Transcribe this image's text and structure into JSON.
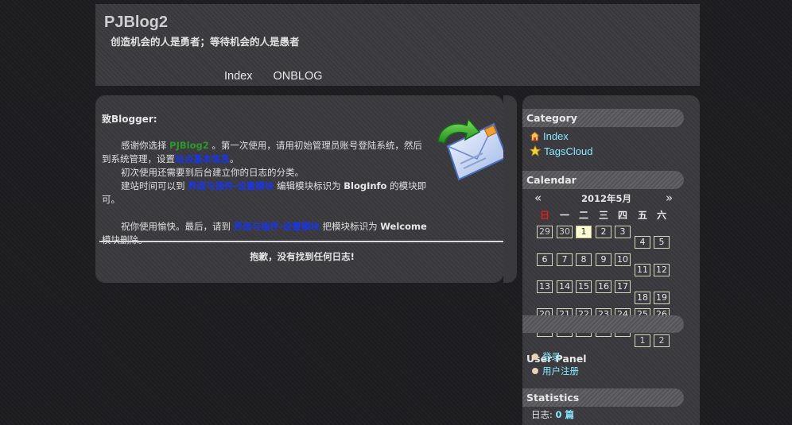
{
  "header": {
    "site_title": "PJBlog2",
    "subtitle": "创造机会的人是勇者；等待机会的人是愚者",
    "nav": [
      "Index",
      "ONBLOG"
    ]
  },
  "notice": {
    "heading": "致Blogger:",
    "p1_a": "感谢你选择 ",
    "p1_link": "PJBlog2",
    "p1_b": " 。第一次使用，请用初始管理员账号登陆系统，然后到系统管理，设置",
    "p1_link2": "站点基本信息",
    "p1_c": "。",
    "p2": "初次使用还需要到后台建立你的日志的分类。",
    "p3_a": "建站时间可以到 ",
    "p3_link": "界面与插件-设置模块",
    "p3_b": " 编辑模块标识为 ",
    "p3_key": "BlogInfo",
    "p3_c": " 的模块即可。",
    "p4_a": "祝你使用愉快。最后，请到 ",
    "p4_link": "界面与插件-设置模块",
    "p4_b": " 把模块标识为 ",
    "p4_key": "Welcome",
    "p4_c": " 模块删除。",
    "no_logs": "抱歉，没有找到任何日志!"
  },
  "sidebar": {
    "category_title": "Category",
    "categories": [
      {
        "label": "Index",
        "icon": "home-icon"
      },
      {
        "label": "TagsCloud",
        "icon": "star-icon"
      }
    ],
    "calendar_title": "Calendar",
    "calendar": {
      "prev": "«",
      "next": "»",
      "month_label": "2012年5月",
      "weekdays": [
        "日",
        "一",
        "二",
        "三",
        "四",
        "五",
        "六"
      ],
      "weekday_colors": [
        "#e02020",
        "#e8e8e8",
        "#e8e8e8",
        "#e8e8e8",
        "#e8e8e8",
        "#e8e8e8",
        "#e8e8e8"
      ],
      "today": "1"
    },
    "user_panel_title": "User Panel",
    "user_links": [
      "登录",
      "用户注册"
    ],
    "statistics_title": "Statistics",
    "stat_label": "日志: ",
    "stat_value": "0",
    "stat_unit": " 篇"
  },
  "colors": {
    "link": "#88e8ff",
    "panel": "#3a3a3e",
    "background": "#1d1d20"
  }
}
